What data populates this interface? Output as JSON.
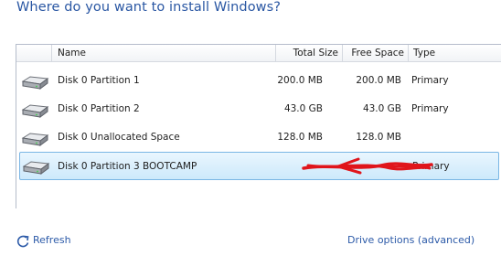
{
  "title": "Where do you want to install Windows?",
  "columns": {
    "name": "Name",
    "total_size": "Total Size",
    "free_space": "Free Space",
    "type": "Type"
  },
  "rows": [
    {
      "name": "Disk 0 Partition 1",
      "total_size": "200.0 MB",
      "free_space": "200.0 MB",
      "type": "Primary"
    },
    {
      "name": "Disk 0 Partition 2",
      "total_size": "43.0 GB",
      "free_space": "43.0 GB",
      "type": "Primary"
    },
    {
      "name": "Disk 0 Unallocated Space",
      "total_size": "128.0 MB",
      "free_space": "128.0 MB",
      "type": ""
    },
    {
      "name": "Disk 0 Partition 3 BOOTCAMP",
      "total_size": "",
      "free_space": "",
      "type": "Primary",
      "selected": true
    }
  ],
  "links": {
    "refresh": "Refresh",
    "drive_options": "Drive options (advanced)"
  },
  "colors": {
    "title": "#2a57a3",
    "link": "#2c5aa8",
    "selection": "#cde9fb",
    "scribble": "#e0151b"
  },
  "icons": {
    "drive": "hard-drive-icon",
    "refresh": "refresh-icon"
  }
}
